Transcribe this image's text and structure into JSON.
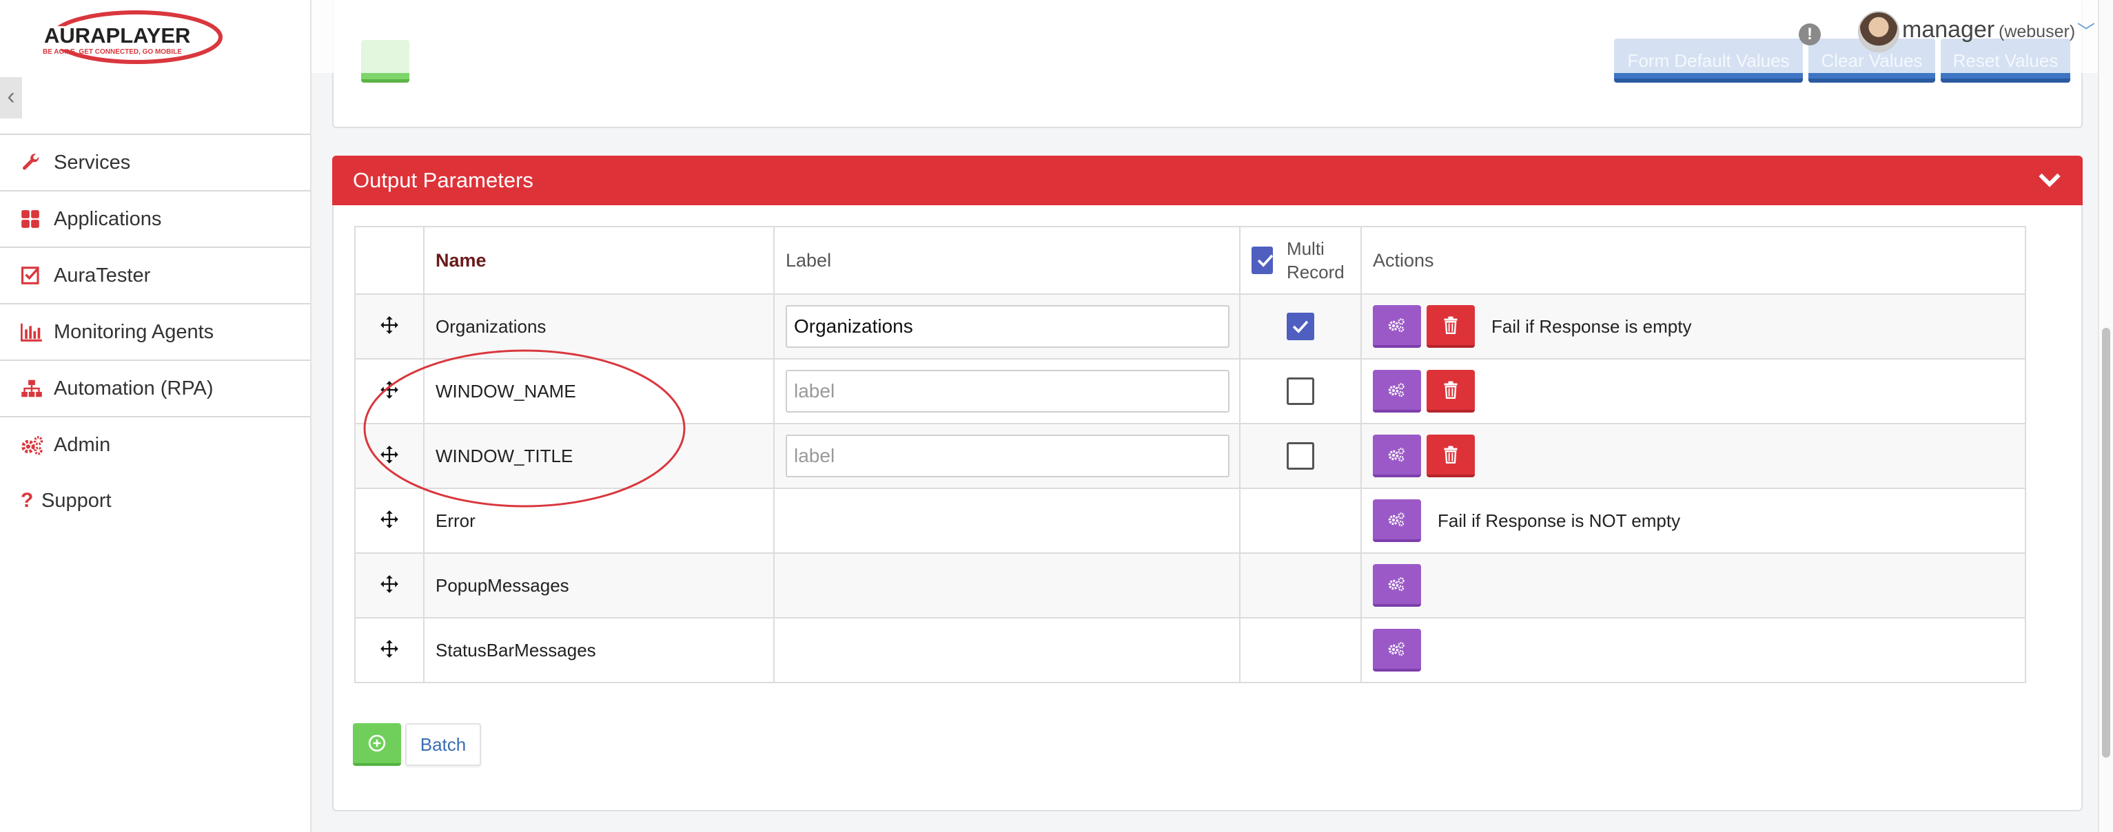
{
  "brand": {
    "logo_text": "AURAPLAYER",
    "logo_tagline": "BE AGILE, GET CONNECTED, GO MOBILE",
    "accent_color": "#de3239"
  },
  "sidebar": {
    "collapse_glyph": "‹",
    "items": [
      {
        "label": "Services",
        "icon": "wrench-icon"
      },
      {
        "label": "Applications",
        "icon": "grid-icon"
      },
      {
        "label": "AuraTester",
        "icon": "checkbox-icon"
      },
      {
        "label": "Monitoring Agents",
        "icon": "bar-chart-icon"
      },
      {
        "label": "Automation (RPA)",
        "icon": "sitemap-icon"
      },
      {
        "label": "Admin",
        "icon": "gears-icon"
      },
      {
        "label": "Support",
        "icon": "question-icon"
      }
    ]
  },
  "user": {
    "name": "manager",
    "role": "(webuser)",
    "alert_glyph": "!",
    "chevron_glyph": "﹀"
  },
  "input_panel": {
    "buttons": {
      "form_default_values": "Form Default Values",
      "clear_values": "Clear Values",
      "reset_values": "Reset Values"
    }
  },
  "output_panel": {
    "title": "Output Parameters",
    "columns": {
      "name": "Name",
      "label": "Label",
      "multi_record": "Multi Record",
      "actions": "Actions"
    },
    "rows": [
      {
        "name": "Organizations",
        "label_value": "Organizations",
        "label_placeholder": "label",
        "multi_record": true,
        "has_delete": true,
        "note": "Fail if Response is empty"
      },
      {
        "name": "WINDOW_NAME",
        "label_value": "",
        "label_placeholder": "label",
        "multi_record": false,
        "has_delete": true,
        "note": ""
      },
      {
        "name": "WINDOW_TITLE",
        "label_value": "",
        "label_placeholder": "label",
        "multi_record": false,
        "has_delete": true,
        "note": ""
      },
      {
        "name": "Error",
        "note": "Fail if Response is NOT empty"
      },
      {
        "name": "PopupMessages",
        "note": ""
      },
      {
        "name": "StatusBarMessages",
        "note": ""
      }
    ],
    "batch_label": "Batch"
  },
  "colors": {
    "settings_button": "#9b59c7",
    "delete_button": "#de3239",
    "add_button": "#6fcf5a",
    "checkbox_checked": "#4e5fc0",
    "highlight_ellipse": "#d9373d"
  }
}
